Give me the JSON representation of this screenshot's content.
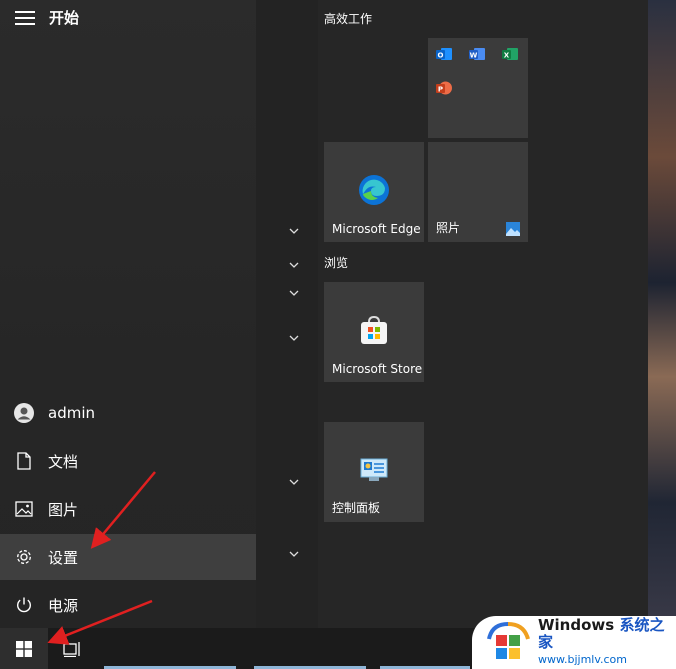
{
  "start_menu": {
    "title": "开始",
    "nav": {
      "user": "admin",
      "documents": "文档",
      "pictures": "图片",
      "settings": "设置",
      "power": "电源"
    }
  },
  "tiles": {
    "group1_title": "高效工作",
    "group2_title": "浏览",
    "office_apps": [
      "outlook-icon",
      "word-icon",
      "excel-icon",
      "powerpoint-icon"
    ],
    "edge_label": "Microsoft Edge",
    "photos_label": "照片",
    "store_label": "Microsoft Store",
    "control_panel_label": "控制面板"
  },
  "watermark": {
    "line1_a": "Windows",
    "line1_b": "系统之家",
    "line2": "www.bjjmlv.com"
  },
  "colors": {
    "accent_arrow": "#e02020",
    "tile_bg": "#3b3b3b",
    "settings_highlight": "#3f3f3f"
  }
}
